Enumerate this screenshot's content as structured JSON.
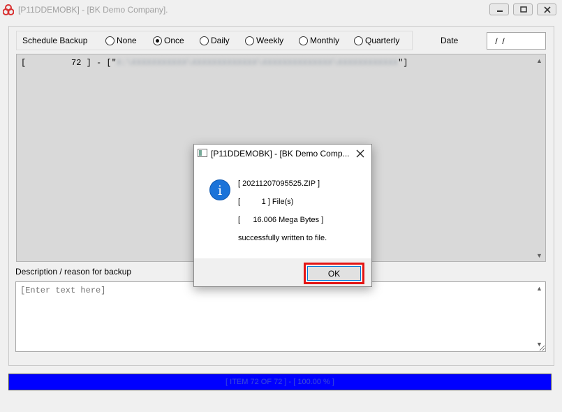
{
  "window": {
    "title": "[P11DDEMOBK] - [BK Demo Company]."
  },
  "schedule": {
    "label": "Schedule Backup",
    "options": [
      "None",
      "Once",
      "Daily",
      "Weekly",
      "Monthly",
      "Quarterly"
    ],
    "selected": "Once"
  },
  "date": {
    "label": "Date",
    "value": " /  /"
  },
  "log": {
    "prefix": "[         72 ] - [\"",
    "path_redacted": "X:\\XXXXXXXXXXX\\XXXXXXXXXXXXX\\XXXXXXXXXXXXXX\\XXXXXXXXXXXX",
    "suffix": "\"]"
  },
  "description": {
    "label": "Description / reason for backup",
    "placeholder": "[Enter text here]"
  },
  "progress": {
    "text": "[ ITEM 72 OF 72 ] - [ 100.00 % ]",
    "fraction": 1.0
  },
  "dialog": {
    "title": "[P11DDEMOBK] - [BK Demo Comp...",
    "line1": "[ 20211207095525.ZIP ]",
    "line2": "[          1 ] File(s)",
    "line3": "[      16.006 Mega Bytes ]",
    "line4": "successfully written to file.",
    "ok_label": "OK"
  },
  "colors": {
    "progress_bar": "#0000ff",
    "highlight_outline": "#e31414",
    "info_icon": "#1a73d9"
  }
}
